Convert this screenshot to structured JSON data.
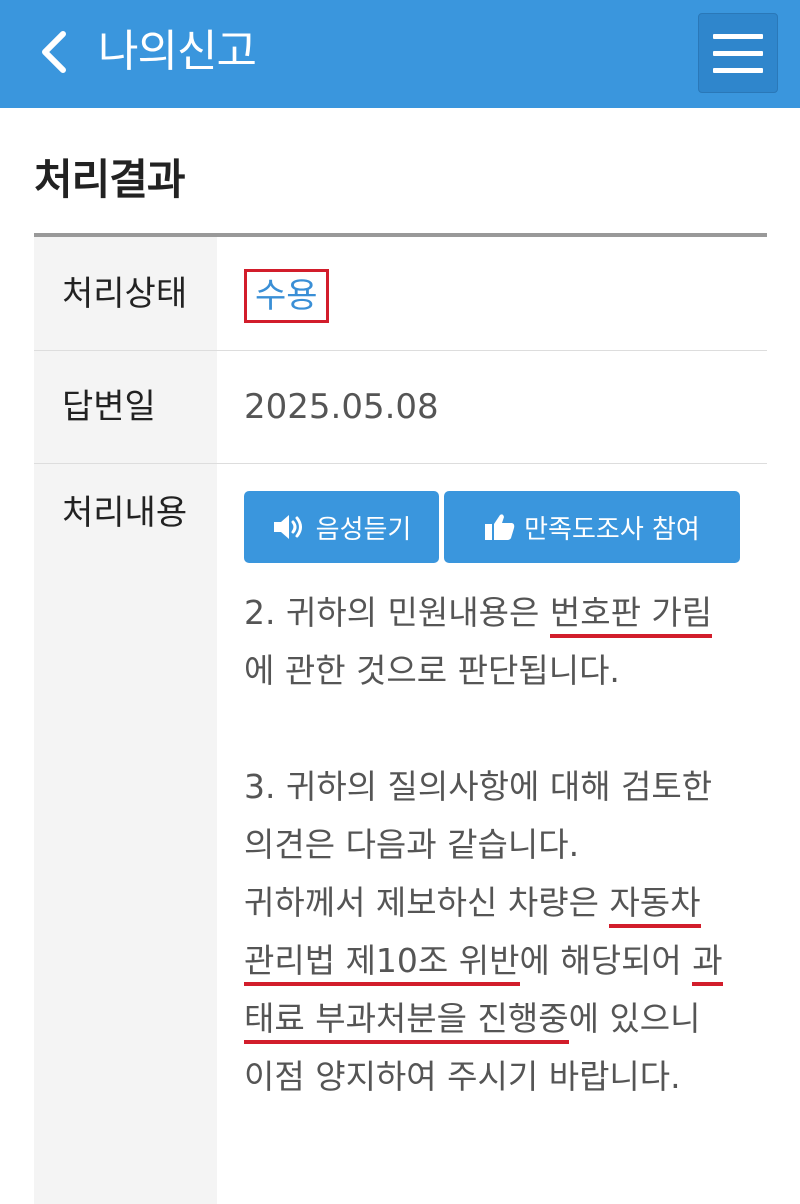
{
  "header": {
    "title": "나의신고"
  },
  "section": {
    "title": "처리결과"
  },
  "rows": {
    "status": {
      "label": "처리상태",
      "value": "수용"
    },
    "date": {
      "label": "답변일",
      "value": "2025.05.08"
    },
    "content": {
      "label": "처리내용"
    }
  },
  "buttons": {
    "voice": "음성듣기",
    "survey": "만족도조사 참여"
  },
  "answer": {
    "l1a": "2. 귀하의 민원내용은 ",
    "l1b": "번호판 가림",
    "l2": "에 관한 것으로 판단됩니다.",
    "l3": "3. 귀하의 질의사항에 대해 검토한",
    "l4": "의견은 다음과 같습니다.",
    "l5a": "귀하께서 제보하신 차량은 ",
    "l5b": "자동차",
    "l6a": "관리법 제10조 위반",
    "l6b": "에 해당되어 ",
    "l6c": "과",
    "l7a": "태료 부과처분을 진행중",
    "l7b": "에 있으니",
    "l8": "이점 양지하여 주시기 바랍니다."
  },
  "colors": {
    "header_bg": "#3a96dd",
    "accent": "#3a8fd6",
    "highlight": "#d21d2b"
  }
}
